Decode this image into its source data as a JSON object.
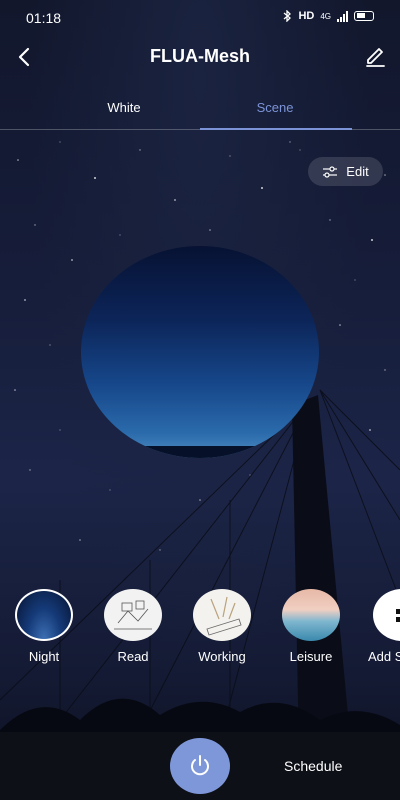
{
  "status_bar": {
    "time": "01:18",
    "hd": "HD",
    "network": "4G"
  },
  "header": {
    "title": "FLUA-Mesh",
    "back_icon": "chevron-left-icon",
    "edit_icon": "pencil-icon"
  },
  "tabs": [
    {
      "label": "White",
      "selected": false
    },
    {
      "label": "Scene",
      "selected": true
    }
  ],
  "edit_pill": {
    "label": "Edit",
    "icon": "sliders-icon"
  },
  "scenes": [
    {
      "label": "Night",
      "selected": true
    },
    {
      "label": "Read",
      "selected": false
    },
    {
      "label": "Working",
      "selected": false
    },
    {
      "label": "Leisure",
      "selected": false
    },
    {
      "label": "Add S",
      "selected": false
    }
  ],
  "bottom": {
    "power_icon": "power-icon",
    "schedule_label": "Schedule"
  },
  "colors": {
    "accent": "#7e97d9",
    "tab_active": "#7c93d8"
  }
}
